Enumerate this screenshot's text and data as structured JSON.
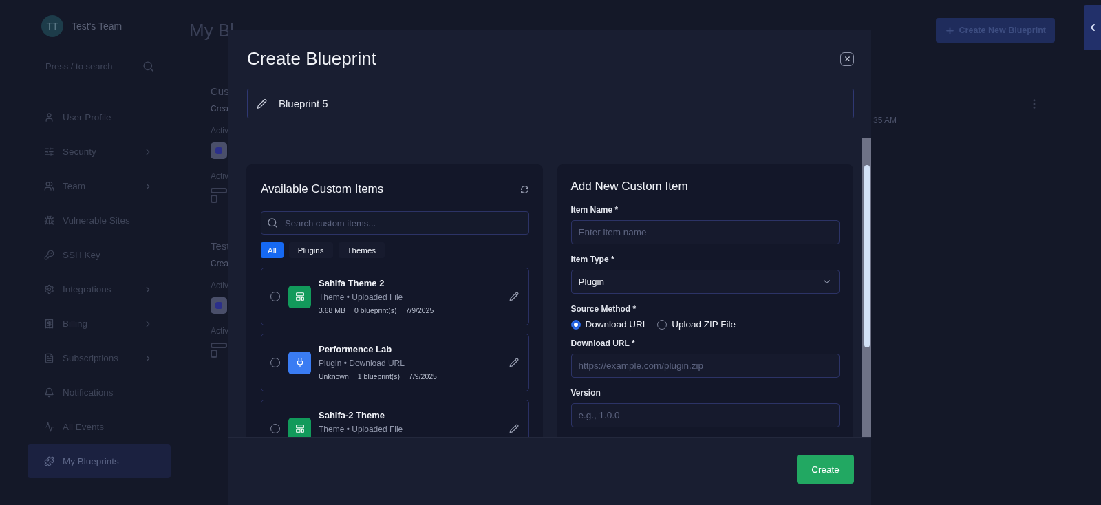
{
  "sidebar": {
    "team": {
      "avatar": "TT",
      "name": "Test's Team"
    },
    "search": {
      "placeholder": "Press / to search"
    },
    "items": [
      {
        "label": "User Profile",
        "expandable": false,
        "selected": false
      },
      {
        "label": "Security",
        "expandable": true,
        "selected": false
      },
      {
        "label": "Team",
        "expandable": true,
        "selected": false
      },
      {
        "label": "Vulnerable Sites",
        "expandable": false,
        "selected": false
      },
      {
        "label": "SSH Key",
        "expandable": false,
        "selected": false
      },
      {
        "label": "Integrations",
        "expandable": true,
        "selected": false
      },
      {
        "label": "Billing",
        "expandable": true,
        "selected": false
      },
      {
        "label": "Subscriptions",
        "expandable": true,
        "selected": false
      },
      {
        "label": "Notifications",
        "expandable": false,
        "selected": false
      },
      {
        "label": "All Events",
        "expandable": false,
        "selected": false
      },
      {
        "label": "My Blueprints",
        "expandable": false,
        "selected": true
      }
    ]
  },
  "page": {
    "title": "My Bl",
    "create_button": "Create New Blueprint",
    "blueprints": [
      {
        "name": "Cus",
        "created": "Crea",
        "time": "35 AM",
        "labels": [
          "Activ",
          "Activ"
        ]
      },
      {
        "name": "Test",
        "created": "Crea",
        "labels": [
          "Activ",
          "Activ"
        ]
      }
    ]
  },
  "modal": {
    "title": "Create Blueprint",
    "name_value": "Blueprint 5",
    "available": {
      "title": "Available Custom Items",
      "search_placeholder": "Search custom items...",
      "filters": [
        {
          "label": "All",
          "selected": true
        },
        {
          "label": "Plugins",
          "selected": false
        },
        {
          "label": "Themes",
          "selected": false
        }
      ],
      "items": [
        {
          "name": "Sahifa Theme 2",
          "kind": "theme",
          "subtitle": "Theme • Uploaded File",
          "meta": [
            "3.68 MB",
            "0 blueprint(s)",
            "7/9/2025"
          ],
          "selected": false
        },
        {
          "name": "Performence Lab",
          "kind": "plugin",
          "subtitle": "Plugin • Download URL",
          "meta": [
            "Unknown",
            "1 blueprint(s)",
            "7/9/2025"
          ],
          "selected": false
        },
        {
          "name": "Sahifa-2 Theme",
          "kind": "theme",
          "subtitle": "Theme • Uploaded File",
          "selected": false
        }
      ]
    },
    "add_form": {
      "title": "Add New Custom Item",
      "fields": [
        {
          "kind": "text",
          "label": "Item Name *",
          "placeholder": "Enter item name"
        },
        {
          "kind": "select",
          "label": "Item Type *",
          "value": "Plugin"
        },
        {
          "kind": "radio",
          "label": "Source Method *",
          "options": [
            {
              "label": "Download URL",
              "selected": true
            },
            {
              "label": "Upload ZIP File",
              "selected": false
            }
          ]
        },
        {
          "kind": "text",
          "label": "Download URL *",
          "placeholder": "https://example.com/plugin.zip"
        },
        {
          "kind": "text",
          "label": "Version",
          "placeholder": "e.g., 1.0.0"
        }
      ]
    },
    "create_button": "Create"
  }
}
